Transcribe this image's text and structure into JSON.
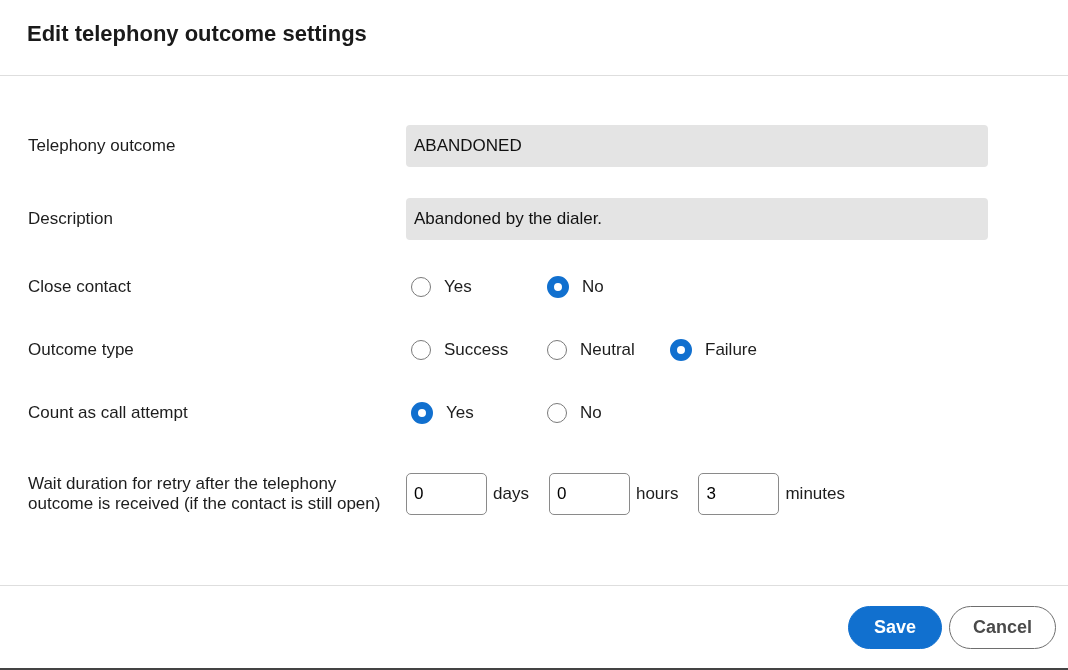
{
  "dialog": {
    "title": "Edit telephony outcome settings"
  },
  "fields": [
    {
      "kind": "text",
      "label": "Telephony outcome",
      "value": "ABANDONED",
      "disabled": true
    },
    {
      "kind": "text",
      "label": "Description",
      "value": "Abandoned by the dialer.",
      "disabled": true
    },
    {
      "kind": "radio",
      "label": "Close contact",
      "options": [
        {
          "label": "Yes",
          "selected": false
        },
        {
          "label": "No",
          "selected": true
        }
      ]
    },
    {
      "kind": "radio",
      "label": "Outcome type",
      "options": [
        {
          "label": "Success",
          "selected": false
        },
        {
          "label": "Neutral",
          "selected": false
        },
        {
          "label": "Failure",
          "selected": true
        }
      ]
    },
    {
      "kind": "radio",
      "label": "Count as call attempt",
      "options": [
        {
          "label": "Yes",
          "selected": true
        },
        {
          "label": "No",
          "selected": false
        }
      ]
    },
    {
      "kind": "duration",
      "label": "Wait duration for retry after the telephony outcome is received (if the contact is still open)",
      "parts": [
        {
          "value": "0",
          "unit": "days"
        },
        {
          "value": "0",
          "unit": "hours"
        },
        {
          "value": "3",
          "unit": "minutes"
        }
      ]
    }
  ],
  "buttons": [
    {
      "label": "Save",
      "kind": "primary"
    },
    {
      "label": "Cancel",
      "kind": "secondary"
    }
  ]
}
